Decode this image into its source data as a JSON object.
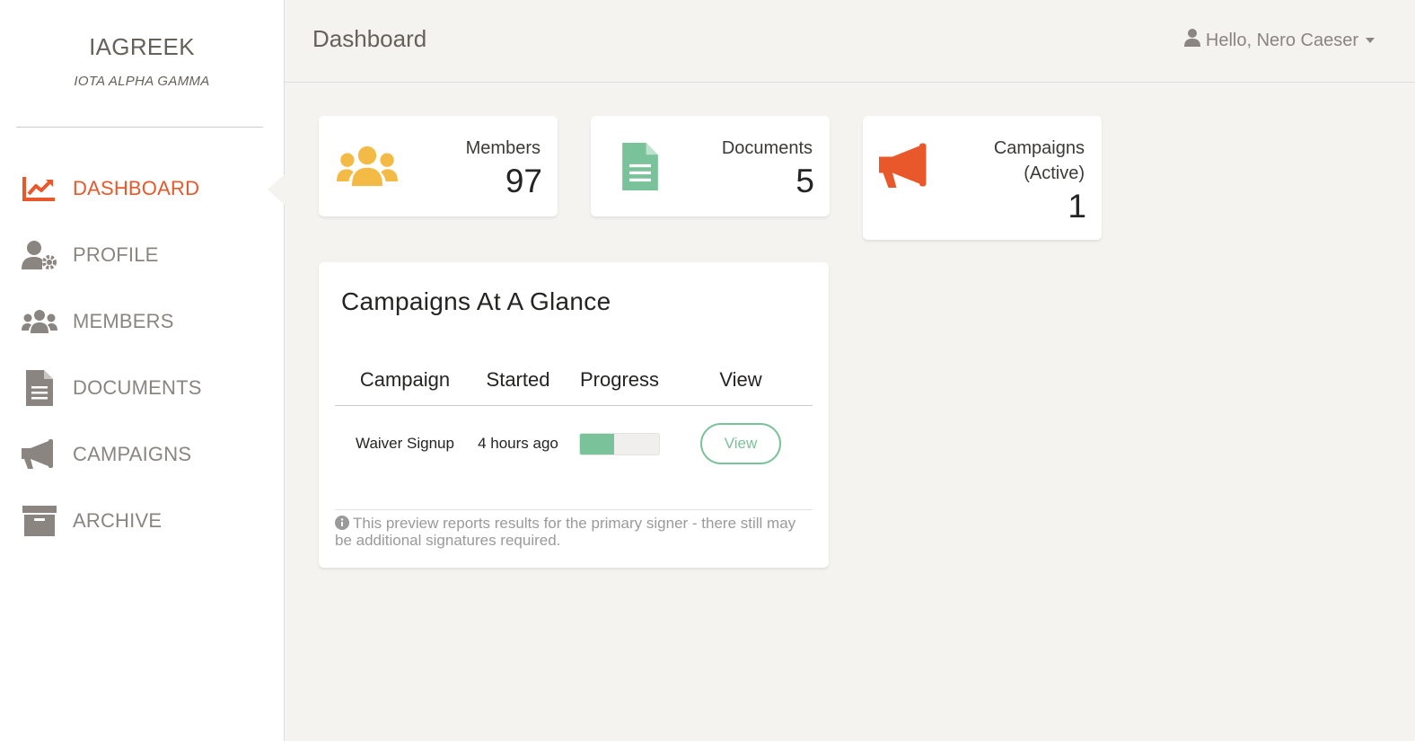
{
  "brand": {
    "name": "IAGREEK",
    "subtitle": "IOTA ALPHA GAMMA"
  },
  "sidebar": {
    "items": [
      {
        "label": "DASHBOARD",
        "icon": "chart-line-icon",
        "active": true
      },
      {
        "label": "PROFILE",
        "icon": "user-gear-icon",
        "active": false
      },
      {
        "label": "MEMBERS",
        "icon": "users-icon",
        "active": false
      },
      {
        "label": "DOCUMENTS",
        "icon": "document-icon",
        "active": false
      },
      {
        "label": "CAMPAIGNS",
        "icon": "megaphone-icon",
        "active": false
      },
      {
        "label": "ARCHIVE",
        "icon": "archive-box-icon",
        "active": false
      }
    ]
  },
  "header": {
    "title": "Dashboard",
    "user_greeting": "Hello, Nero Caeser"
  },
  "stats": [
    {
      "label": "Members",
      "value": "97",
      "icon": "users-icon",
      "color": "#f3bb45"
    },
    {
      "label": "Documents",
      "value": "5",
      "icon": "document-icon",
      "color": "#7ac29a"
    },
    {
      "label": "Campaigns (Active)",
      "value": "1",
      "icon": "megaphone-icon",
      "color": "#e8582a"
    }
  ],
  "glance": {
    "title": "Campaigns At A Glance",
    "columns": [
      "Campaign",
      "Started",
      "Progress",
      "View"
    ],
    "rows": [
      {
        "campaign": "Waiver Signup",
        "started": "4 hours ago",
        "progress": 0.43,
        "view_label": "View"
      }
    ],
    "footnote": "This preview reports results for the primary signer - there still may be additional signatures required."
  },
  "colors": {
    "accent": "#e8582a",
    "success": "#7ac29a",
    "warning": "#f3bb45",
    "muted": "#8a8580"
  }
}
